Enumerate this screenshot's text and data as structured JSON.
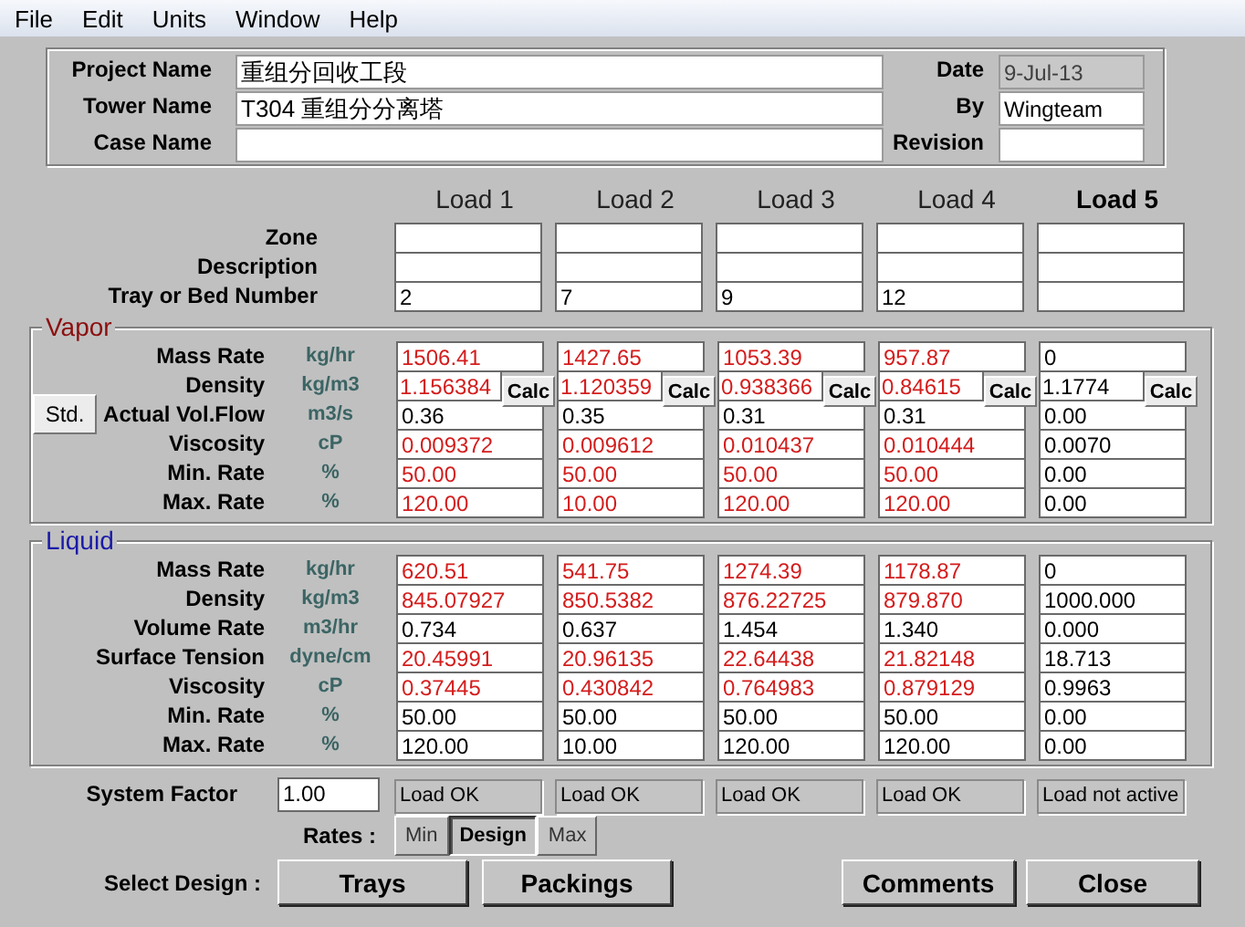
{
  "menu": [
    "File",
    "Edit",
    "Units",
    "Window",
    "Help"
  ],
  "header_left": [
    {
      "label": "Project Name",
      "value": "重组分回收工段"
    },
    {
      "label": "Tower Name",
      "value": "T304 重组分分离塔"
    },
    {
      "label": "Case Name"
    }
  ],
  "header_right": [
    {
      "label": "Date",
      "value": "9-Jul-13",
      "disabled": true
    },
    {
      "label": "By",
      "value": "Wingteam",
      "disabled": false
    },
    {
      "label": "Revision",
      "disabled": false
    }
  ],
  "loads": [
    {
      "label": "Load 1",
      "selected": false
    },
    {
      "label": "Load 2",
      "selected": false
    },
    {
      "label": "Load 3",
      "selected": false
    },
    {
      "label": "Load 4",
      "selected": false
    },
    {
      "label": "Load 5",
      "selected": true
    }
  ],
  "load_rows": [
    {
      "label": "Zone",
      "values": []
    },
    {
      "label": "Description",
      "values": []
    },
    {
      "label": "Tray or Bed Number",
      "values": [
        "2",
        "7",
        "9",
        "12"
      ]
    }
  ],
  "vapor": {
    "title": "Vapor",
    "rows": [
      {
        "label": "Mass Rate",
        "unit": "kg/hr",
        "cells": [
          {
            "value": "1506.41",
            "flagged": true
          },
          {
            "value": "1427.65",
            "flagged": true
          },
          {
            "value": "1053.39",
            "flagged": true
          },
          {
            "value": "957.87",
            "flagged": true
          },
          {
            "value": "0",
            "flagged": false
          }
        ]
      },
      {
        "label": "Density",
        "unit": "kg/m3",
        "cells": [
          {
            "value": "1.156384",
            "flagged": true,
            "button": "Calc"
          },
          {
            "value": "1.120359",
            "flagged": true,
            "button": "Calc"
          },
          {
            "value": "0.938366",
            "flagged": true,
            "button": "Calc"
          },
          {
            "value": "0.84615",
            "flagged": true,
            "button": "Calc"
          },
          {
            "value": "1.1774",
            "flagged": false,
            "button": "Calc"
          }
        ]
      },
      {
        "label": "Actual Vol.Flow",
        "unit": "m3/s",
        "button": "Std.",
        "cells": [
          {
            "value": "0.36",
            "flagged": false
          },
          {
            "value": "0.35",
            "flagged": false
          },
          {
            "value": "0.31",
            "flagged": false
          },
          {
            "value": "0.31",
            "flagged": false
          },
          {
            "value": "0.00",
            "flagged": false
          }
        ]
      },
      {
        "label": "Viscosity",
        "unit": "cP",
        "cells": [
          {
            "value": "0.009372",
            "flagged": true
          },
          {
            "value": "0.009612",
            "flagged": true
          },
          {
            "value": "0.010437",
            "flagged": true
          },
          {
            "value": "0.010444",
            "flagged": true
          },
          {
            "value": "0.0070",
            "flagged": false
          }
        ]
      },
      {
        "label": "Min. Rate",
        "unit": "%",
        "cells": [
          {
            "value": "50.00",
            "flagged": true
          },
          {
            "value": "50.00",
            "flagged": true
          },
          {
            "value": "50.00",
            "flagged": true
          },
          {
            "value": "50.00",
            "flagged": true
          },
          {
            "value": "0.00",
            "flagged": false
          }
        ]
      },
      {
        "label": "Max. Rate",
        "unit": "%",
        "cells": [
          {
            "value": "120.00",
            "flagged": true
          },
          {
            "value": "10.00",
            "flagged": true
          },
          {
            "value": "120.00",
            "flagged": true
          },
          {
            "value": "120.00",
            "flagged": true
          },
          {
            "value": "0.00",
            "flagged": false
          }
        ]
      }
    ]
  },
  "liquid": {
    "title": "Liquid",
    "rows": [
      {
        "label": "Mass Rate",
        "unit": "kg/hr",
        "cells": [
          {
            "value": "620.51",
            "flagged": true
          },
          {
            "value": "541.75",
            "flagged": true
          },
          {
            "value": "1274.39",
            "flagged": true
          },
          {
            "value": "1178.87",
            "flagged": true
          },
          {
            "value": "0",
            "flagged": false
          }
        ]
      },
      {
        "label": "Density",
        "unit": "kg/m3",
        "cells": [
          {
            "value": "845.07927",
            "flagged": true
          },
          {
            "value": "850.5382",
            "flagged": true
          },
          {
            "value": "876.22725",
            "flagged": true
          },
          {
            "value": "879.870",
            "flagged": true
          },
          {
            "value": "1000.000",
            "flagged": false
          }
        ]
      },
      {
        "label": "Volume Rate",
        "unit": "m3/hr",
        "cells": [
          {
            "value": "0.734",
            "flagged": false
          },
          {
            "value": "0.637",
            "flagged": false
          },
          {
            "value": "1.454",
            "flagged": false
          },
          {
            "value": "1.340",
            "flagged": false
          },
          {
            "value": "0.000",
            "flagged": false
          }
        ]
      },
      {
        "label": "Surface Tension",
        "unit": "dyne/cm",
        "cells": [
          {
            "value": "20.45991",
            "flagged": true
          },
          {
            "value": "20.96135",
            "flagged": true
          },
          {
            "value": "22.64438",
            "flagged": true
          },
          {
            "value": "21.82148",
            "flagged": true
          },
          {
            "value": "18.713",
            "flagged": false
          }
        ]
      },
      {
        "label": "Viscosity",
        "unit": "cP",
        "cells": [
          {
            "value": "0.37445",
            "flagged": true
          },
          {
            "value": "0.430842",
            "flagged": true
          },
          {
            "value": "0.764983",
            "flagged": true
          },
          {
            "value": "0.879129",
            "flagged": true
          },
          {
            "value": "0.9963",
            "flagged": false
          }
        ]
      },
      {
        "label": "Min. Rate",
        "unit": "%",
        "cells": [
          {
            "value": "50.00",
            "flagged": false
          },
          {
            "value": "50.00",
            "flagged": false
          },
          {
            "value": "50.00",
            "flagged": false
          },
          {
            "value": "50.00",
            "flagged": false
          },
          {
            "value": "0.00",
            "flagged": false
          }
        ]
      },
      {
        "label": "Max. Rate",
        "unit": "%",
        "cells": [
          {
            "value": "120.00",
            "flagged": false
          },
          {
            "value": "10.00",
            "flagged": false
          },
          {
            "value": "120.00",
            "flagged": false
          },
          {
            "value": "120.00",
            "flagged": false
          },
          {
            "value": "0.00",
            "flagged": false
          }
        ]
      }
    ]
  },
  "system_factor": {
    "label": "System Factor",
    "value": "1.00"
  },
  "load_status": [
    "Load OK",
    "Load OK",
    "Load OK",
    "Load OK",
    "Load not active"
  ],
  "rates": {
    "label": "Rates :",
    "options": [
      {
        "label": "Min",
        "selected": false
      },
      {
        "label": "Design",
        "selected": true
      },
      {
        "label": "Max",
        "selected": false
      }
    ]
  },
  "select_design": {
    "label": "Select Design :",
    "buttons": [
      "Trays",
      "Packings"
    ]
  },
  "actions": [
    "Comments",
    "Close"
  ]
}
